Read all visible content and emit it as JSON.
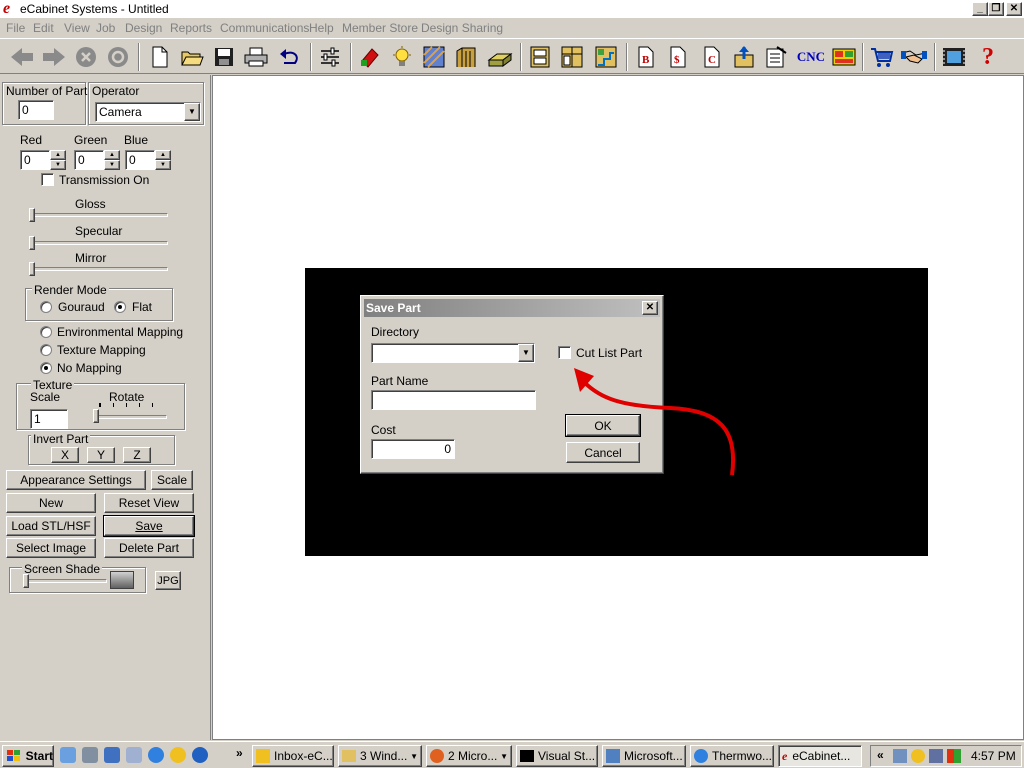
{
  "window": {
    "title": "eCabinet Systems - Untitled",
    "icon_letter": "e",
    "min_label": "_",
    "restore_label": "❐",
    "close_label": "✕"
  },
  "menu": [
    "File",
    "Edit",
    "View",
    "Job",
    "Design",
    "Reports",
    "Communications",
    "Help",
    "Member Store",
    "Design Sharing"
  ],
  "toolbar": {
    "icons": [
      "back-arrow-icon",
      "forward-arrow-icon",
      "stop-icon",
      "refresh-icon",
      "new-file-icon",
      "open-folder-icon",
      "save-disk-icon",
      "print-icon",
      "undo-icon",
      "settings-sliders-icon",
      "tool-red-icon",
      "light-bulb-icon",
      "texture-icon",
      "door-frame-icon",
      "drawer-box-icon",
      "cabinet-icon",
      "cabinet-double-icon",
      "cabinet-stair-icon",
      "report-b-icon",
      "report-dollar-icon",
      "report-c-icon",
      "export-icon",
      "checklist-icon",
      "cnc-icon",
      "layout-icon",
      "shopping-cart-icon",
      "handshake-icon",
      "film-icon",
      "help-icon"
    ],
    "report_b_label": "B",
    "report_dollar_label": "$",
    "report_c_label": "C",
    "cnc_label": "CNC",
    "help_label": "?"
  },
  "left": {
    "number_of_part_label": "Number of Part",
    "number_of_part_value": "0",
    "operator_label": "Operator",
    "operator_value": "Camera",
    "red_label": "Red",
    "green_label": "Green",
    "blue_label": "Blue",
    "red_value": "0",
    "green_value": "0",
    "blue_value": "0",
    "transmission_label": "Transmission On",
    "gloss_label": "Gloss",
    "specular_label": "Specular",
    "mirror_label": "Mirror",
    "render_mode_label": "Render Mode",
    "gouraud_label": "Gouraud",
    "flat_label": "Flat",
    "env_mapping_label": "Environmental Mapping",
    "texture_mapping_label": "Texture Mapping",
    "no_mapping_label": "No Mapping",
    "texture_label": "Texture",
    "scale_label": "Scale",
    "rotate_label": "Rotate",
    "scale_value": "1",
    "invert_part_label": "Invert Part",
    "x_label": "X",
    "y_label": "Y",
    "z_label": "Z",
    "appearance_settings_label": "Appearance Settings",
    "scale_button_label": "Scale",
    "new_label": "New",
    "reset_view_label": "Reset View",
    "load_stl_label": "Load STL/HSF",
    "save_label": "Save",
    "select_image_label": "Select Image",
    "delete_part_label": "Delete Part",
    "screen_shade_label": "Screen Shade",
    "jpg_label": "JPG"
  },
  "dialog": {
    "title": "Save Part",
    "close_label": "✕",
    "directory_label": "Directory",
    "directory_value": "",
    "cut_list_label": "Cut List Part",
    "part_name_label": "Part Name",
    "part_name_value": "",
    "cost_label": "Cost",
    "cost_value": "0",
    "ok_label": "OK",
    "cancel_label": "Cancel"
  },
  "taskbar": {
    "start_label": "Start",
    "chevron_label": "»",
    "tray_chevron_label": "«",
    "tasks": [
      "Inbox-eC...",
      "3 Wind...",
      "2 Micro...",
      "Visual St...",
      "Microsoft...",
      "Thermwo...",
      "eCabinet..."
    ],
    "time": "4:57 PM"
  }
}
